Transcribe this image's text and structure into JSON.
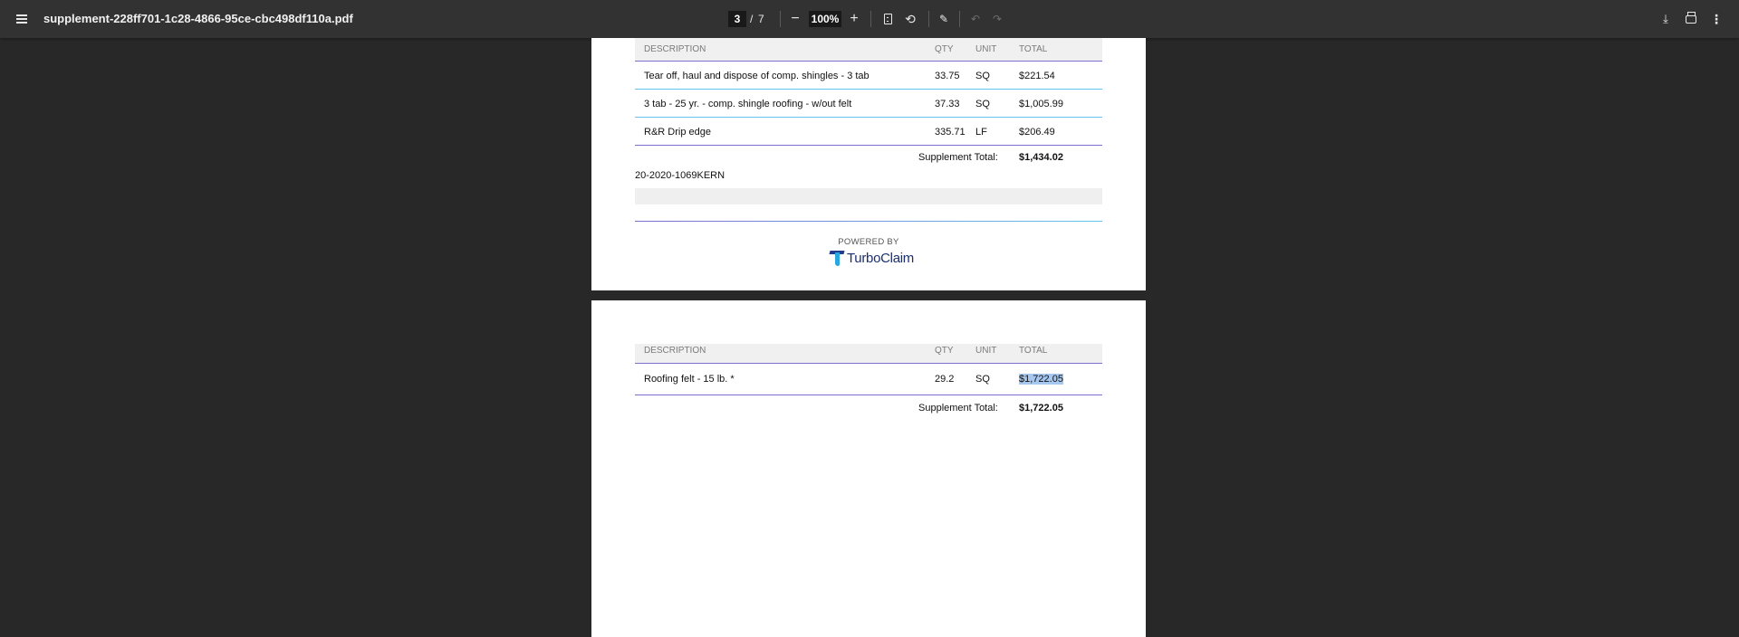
{
  "toolbar": {
    "file_name": "supplement-228ff701-1c28-4866-95ce-cbc498df110a.pdf",
    "current_page": "3",
    "page_separator": "/",
    "total_pages": "7",
    "zoom_out_label": "−",
    "zoom_level": "100%",
    "zoom_in_label": "+",
    "icons": {
      "menu": "menu-icon",
      "fit": "fit-to-page-icon",
      "rotate": "rotate-icon",
      "annotate": "annotate-icon",
      "undo": "undo-icon",
      "redo": "redo-icon",
      "download": "download-icon",
      "print": "print-icon",
      "more": "more-vert-icon"
    }
  },
  "columns": {
    "description": "DESCRIPTION",
    "qty": "QTY",
    "unit": "UNIT",
    "total": "TOTAL"
  },
  "page1": {
    "rows": [
      {
        "description": "Tear off, haul and dispose of comp. shingles - 3 tab",
        "qty": "33.75",
        "unit": "SQ",
        "total": "$221.54"
      },
      {
        "description": "3 tab - 25 yr. - comp. shingle roofing - w/out felt",
        "qty": "37.33",
        "unit": "SQ",
        "total": "$1,005.99"
      },
      {
        "description": "R&R Drip edge",
        "qty": "335.71",
        "unit": "LF",
        "total": "$206.49"
      }
    ],
    "supplement_label": "Supplement Total:",
    "supplement_total": "$1,434.02",
    "claim_id": "20-2020-1069KERN",
    "powered_by": "POWERED BY",
    "brand_name": "TurboClaim"
  },
  "page2": {
    "rows": [
      {
        "description": "Roofing felt - 15 lb. *",
        "qty": "29.2",
        "unit": "SQ",
        "total": "$1,722.05"
      }
    ],
    "supplement_label": "Supplement Total:",
    "supplement_total": "$1,722.05"
  },
  "colors": {
    "toolbar_bg": "#323232",
    "viewer_bg": "#282828",
    "accent_purple": "#7b6fd0",
    "accent_blue": "#66c4ee",
    "selection": "#a6c8f0"
  }
}
